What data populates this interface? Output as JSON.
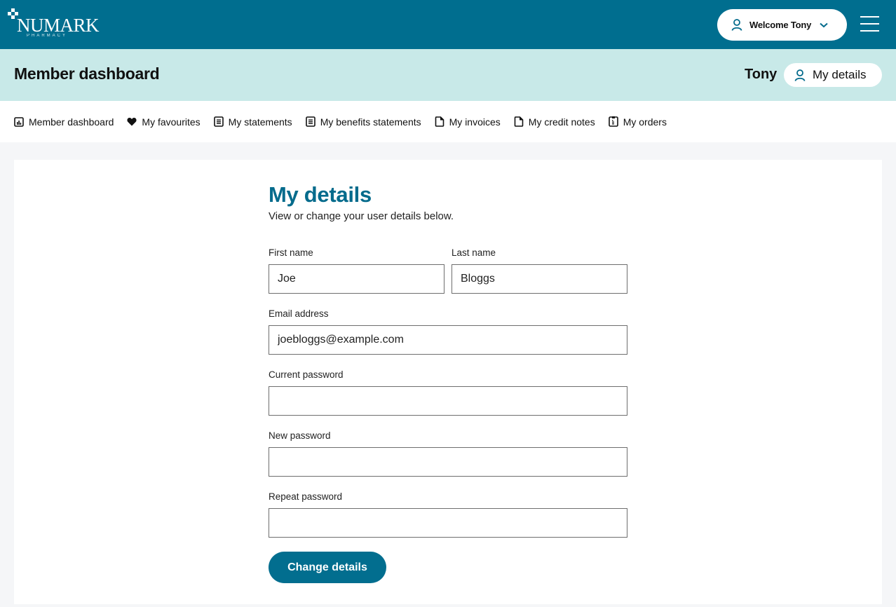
{
  "header": {
    "brand": "NUMARK",
    "brand_sub": "PHARMACY",
    "welcome_label": "Welcome Tony",
    "brand_color": "#006e8f"
  },
  "subheader": {
    "title": "Member dashboard",
    "user_name": "Tony",
    "my_details_label": "My details",
    "background": "#c8e9e8"
  },
  "nav": {
    "items": [
      {
        "label": "Member dashboard",
        "icon": "chart-icon"
      },
      {
        "label": "My favourites",
        "icon": "heart-icon"
      },
      {
        "label": "My statements",
        "icon": "document-lines-icon"
      },
      {
        "label": "My benefits statements",
        "icon": "document-lines-icon"
      },
      {
        "label": "My invoices",
        "icon": "file-icon"
      },
      {
        "label": "My credit notes",
        "icon": "file-icon"
      },
      {
        "label": "My orders",
        "icon": "clipboard-icon"
      }
    ]
  },
  "form": {
    "title": "My details",
    "intro": "View or change your user details below.",
    "first_name": {
      "label": "First name",
      "value": "Joe"
    },
    "last_name": {
      "label": "Last name",
      "value": "Bloggs"
    },
    "email": {
      "label": "Email address",
      "value": "joebloggs@example.com"
    },
    "current_password": {
      "label": "Current password",
      "value": ""
    },
    "new_password": {
      "label": "New password",
      "value": ""
    },
    "repeat_password": {
      "label": "Repeat password",
      "value": ""
    },
    "submit_label": "Change details"
  }
}
